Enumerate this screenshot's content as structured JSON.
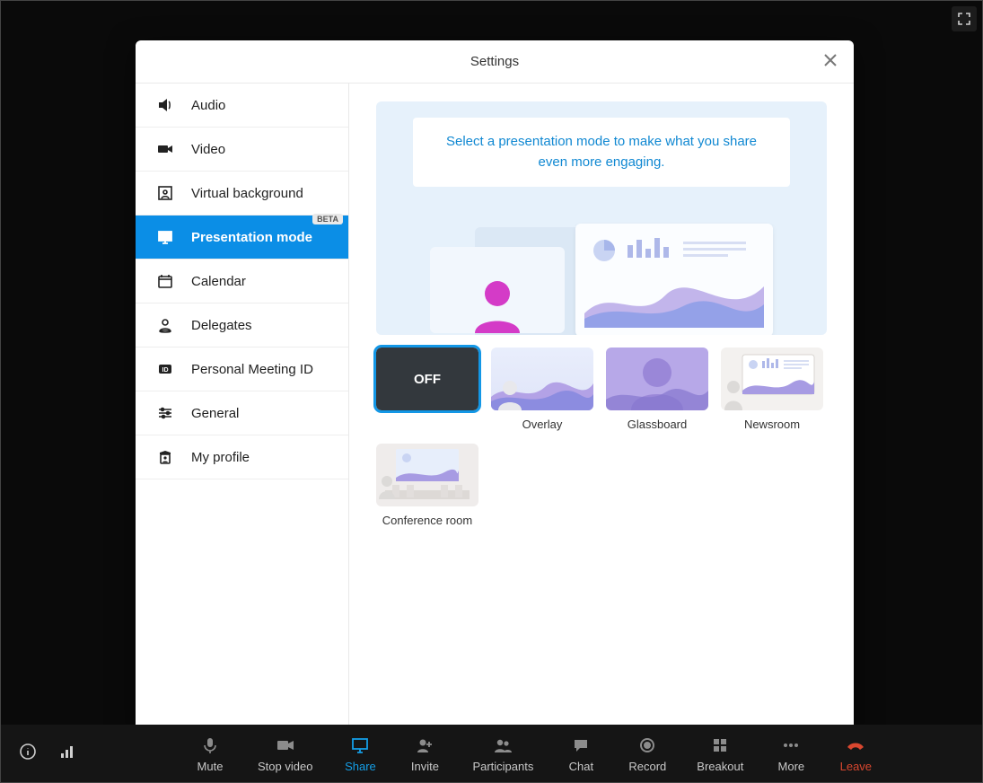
{
  "modal": {
    "title": "Settings",
    "nav": [
      {
        "id": "audio",
        "label": "Audio"
      },
      {
        "id": "video",
        "label": "Video"
      },
      {
        "id": "virtual-bg",
        "label": "Virtual background"
      },
      {
        "id": "presentation",
        "label": "Presentation mode",
        "badge": "BETA",
        "selected": true
      },
      {
        "id": "calendar",
        "label": "Calendar"
      },
      {
        "id": "delegates",
        "label": "Delegates"
      },
      {
        "id": "pmi",
        "label": "Personal Meeting ID"
      },
      {
        "id": "general",
        "label": "General"
      },
      {
        "id": "profile",
        "label": "My profile"
      }
    ],
    "hero_text": "Select a presentation mode to make what you share even more engaging.",
    "modes": [
      {
        "id": "off",
        "label": "OFF",
        "selected": true,
        "show_caption": false
      },
      {
        "id": "overlay",
        "label": "Overlay"
      },
      {
        "id": "glassboard",
        "label": "Glassboard"
      },
      {
        "id": "newsroom",
        "label": "Newsroom"
      },
      {
        "id": "conference",
        "label": "Conference room"
      }
    ]
  },
  "toolbar": {
    "mute": "Mute",
    "stop_video": "Stop video",
    "share": "Share",
    "invite": "Invite",
    "participants": "Participants",
    "chat": "Chat",
    "record": "Record",
    "breakout": "Breakout",
    "more": "More",
    "leave": "Leave"
  },
  "colors": {
    "accent": "#0b8ee6",
    "danger": "#d9472f"
  }
}
